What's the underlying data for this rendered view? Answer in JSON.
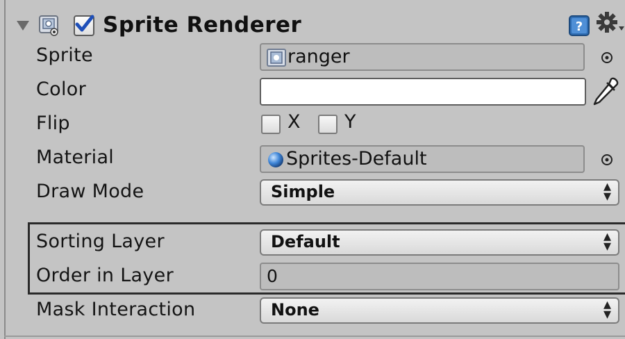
{
  "component": {
    "title": "Sprite Renderer",
    "enabled": true,
    "icons": {
      "fold": "fold-arrow-icon",
      "component": "sprite-renderer-icon",
      "help": "help-icon",
      "settings": "gear-icon"
    }
  },
  "properties": {
    "sprite": {
      "label": "Sprite",
      "value": "ranger",
      "icon": "sprite-asset-icon"
    },
    "color": {
      "label": "Color",
      "value": "#ffffff"
    },
    "flip": {
      "label": "Flip",
      "x_label": "X",
      "y_label": "Y",
      "x_checked": false,
      "y_checked": false
    },
    "material": {
      "label": "Material",
      "value": "Sprites-Default",
      "icon": "material-sphere-icon"
    },
    "draw_mode": {
      "label": "Draw Mode",
      "value": "Simple"
    },
    "sorting_layer": {
      "label": "Sorting Layer",
      "value": "Default"
    },
    "order_in_layer": {
      "label": "Order in Layer",
      "value": "0"
    },
    "mask_interaction": {
      "label": "Mask Interaction",
      "value": "None"
    }
  },
  "colors": {
    "panel_bg": "#c4c4c4",
    "highlight_border": "#2a2a2a",
    "checkbox_check": "#1e4fb8"
  }
}
